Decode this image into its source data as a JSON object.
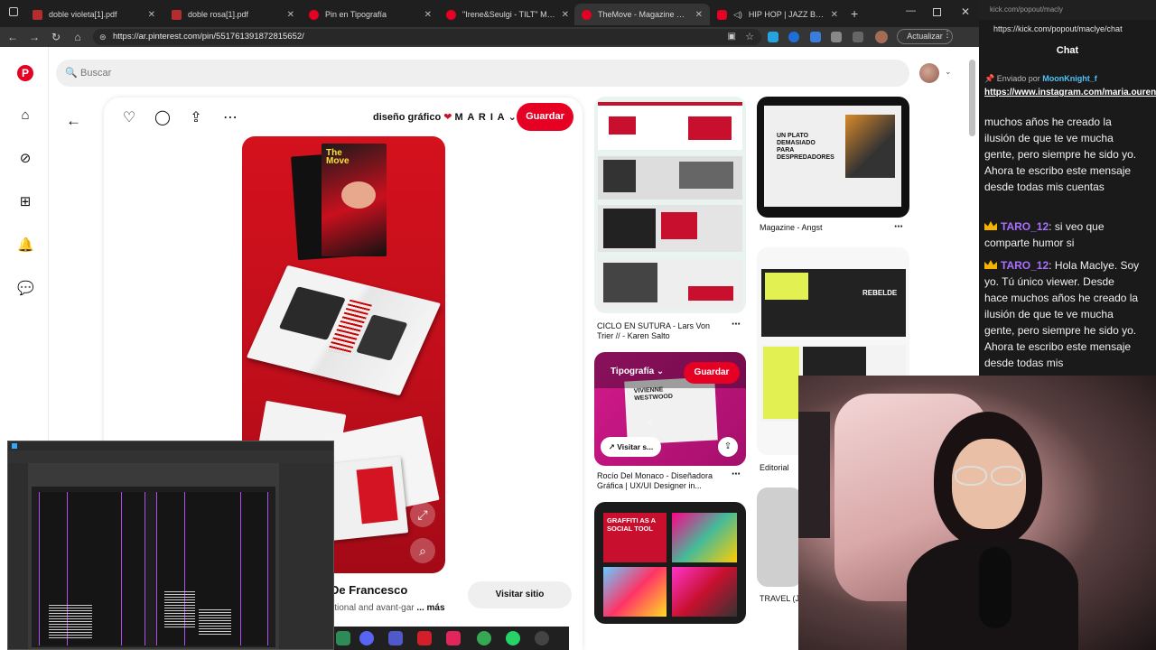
{
  "tabs": [
    {
      "title": "doble violeta[1].pdf",
      "icon": "pdf-icon"
    },
    {
      "title": "doble rosa[1].pdf",
      "icon": "pdf-icon"
    },
    {
      "title": "Pin en Tipografía",
      "icon": "pinterest-icon"
    },
    {
      "title": "\"Irene&Seulgi - TILT\" Magazine",
      "icon": "pinterest-icon"
    },
    {
      "title": "TheMove - Magazine Design -",
      "icon": "pinterest-icon"
    },
    {
      "title": "HIP HOP | JAZZ BOOM B",
      "icon": "youtube-icon"
    }
  ],
  "address": {
    "url": "https://ar.pinterest.com/pin/551761391872815652/",
    "update_label": "Actualizar"
  },
  "pinterest": {
    "search_placeholder": "Buscar",
    "board_name_prefix": "diseño gráfico",
    "board_name_suffix": "M A R I A",
    "save_label": "Guardar",
    "author": "De Francesco",
    "description": "itional and avant-gar",
    "more_label": "... más",
    "visit_label": "Visitar sitio",
    "mag_title": "The Move",
    "grid": [
      {
        "caption": "CICLO EN SUTURA - Lars Von Trier // - Karen Salto"
      },
      {
        "caption": "Rocío Del Monaco - Diseñadora Gráfica | UX/UI Designer in..."
      },
      {
        "caption": "Magazine - Angst"
      },
      {
        "caption": "Editorial"
      },
      {
        "caption": "TRAVEL (J"
      }
    ],
    "hover_board": "Tipografía",
    "hover_save": "Guardar",
    "hover_visit": "Visitar s...",
    "card_text": {
      "vivienne": "VIVIENNE WESTWOOD",
      "graffiti": "GRAFFITI AS A SOCIAL TOOL",
      "rebelde": "REBELDE",
      "plato": "UN PLATO DEMASIADO PARA DESPREDADORES"
    }
  },
  "chat": {
    "url": "https://kick.com/popout/maclye/chat",
    "tab_url": "kick.com/popout/macly",
    "title": "Chat",
    "sent_by_prefix": "Enviado por",
    "sent_by_user": "MoonKnight_f",
    "link": "https://www.instagram.com/maria.ourens?...",
    "messages": [
      {
        "user": "",
        "text": "muchos años he creado la ilusión de que te ve mucha gente, pero siempre he sido yo. Ahora te escribo este mensaje desde todas mis cuentas"
      },
      {
        "user": "TARO_12",
        "text": "si veo que comparte humor si"
      },
      {
        "user": "TARO_12",
        "text": "Hola Maclye. Soy yo. Tú único viewer. Desde hace muchos años he creado la ilusión de que te ve mucha gente, pero siempre he sido yo. Ahora te escribo este mensaje desde todas mis"
      }
    ]
  },
  "colors": {
    "pinterest_red": "#e60023",
    "kick_purple": "#a970ff",
    "chat_bg": "#1a1a1a"
  }
}
